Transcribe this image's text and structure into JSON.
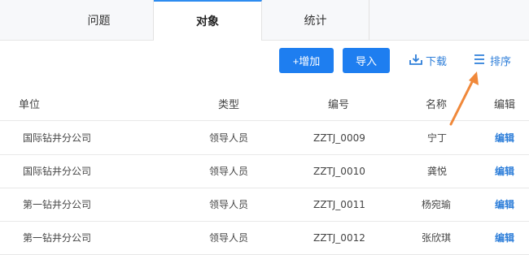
{
  "tabs": [
    {
      "label": "问题",
      "active": false
    },
    {
      "label": "对象",
      "active": true
    },
    {
      "label": "统计",
      "active": false
    }
  ],
  "toolbar": {
    "add_label": "+增加",
    "import_label": "导入",
    "download_label": "下载",
    "sort_label": "排序",
    "accent_color": "#1e7ef0",
    "link_color": "#2d7ed9"
  },
  "table": {
    "headers": [
      "单位",
      "类型",
      "编号",
      "名称",
      "编辑"
    ],
    "rows": [
      {
        "unit": "国际钻井分公司",
        "type": "领导人员",
        "code": "ZZTJ_0009",
        "name": "宁丁",
        "edit": "编辑"
      },
      {
        "unit": "国际钻井分公司",
        "type": "领导人员",
        "code": "ZZTJ_0010",
        "name": "龚悦",
        "edit": "编辑"
      },
      {
        "unit": "第一钻井分公司",
        "type": "领导人员",
        "code": "ZZTJ_0011",
        "name": "杨宛瑜",
        "edit": "编辑"
      },
      {
        "unit": "第一钻井分公司",
        "type": "领导人员",
        "code": "ZZTJ_0012",
        "name": "张欣琪",
        "edit": "编辑"
      }
    ]
  },
  "annotation": {
    "color": "#f0883a"
  }
}
